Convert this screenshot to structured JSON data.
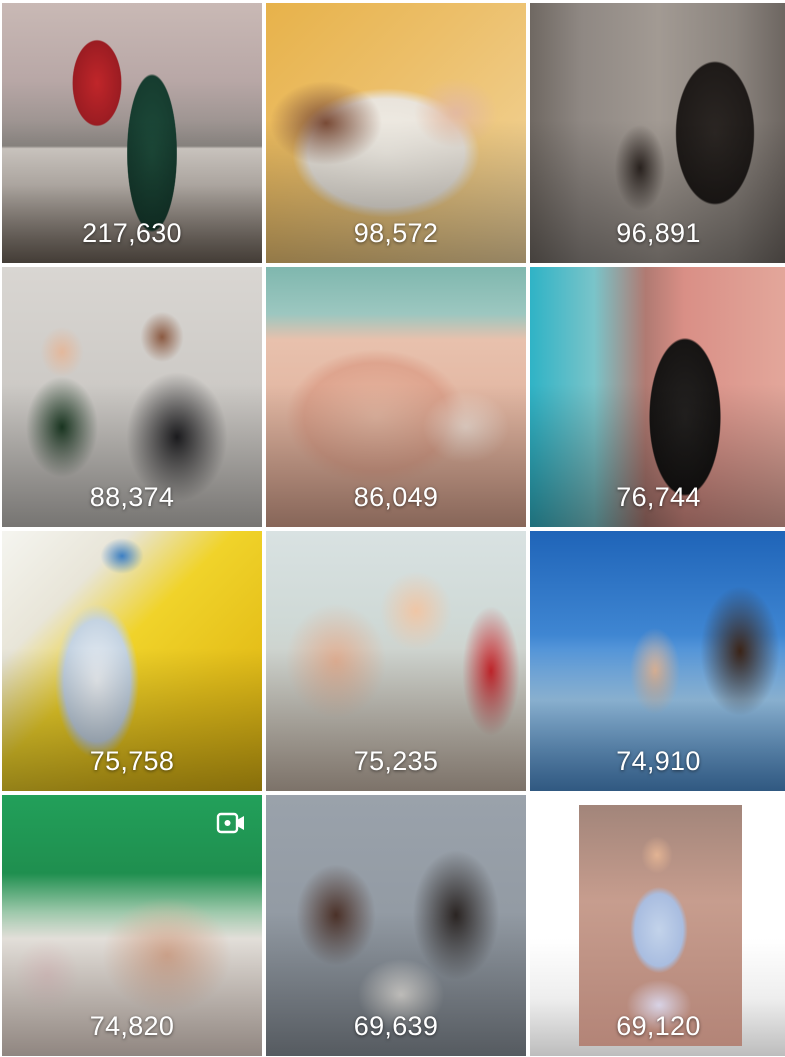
{
  "grid": {
    "tiles": [
      {
        "count": "217,630",
        "kind": "photo"
      },
      {
        "count": "98,572",
        "kind": "photo"
      },
      {
        "count": "96,891",
        "kind": "photo"
      },
      {
        "count": "88,374",
        "kind": "photo"
      },
      {
        "count": "86,049",
        "kind": "photo"
      },
      {
        "count": "76,744",
        "kind": "photo"
      },
      {
        "count": "75,758",
        "kind": "photo"
      },
      {
        "count": "75,235",
        "kind": "photo"
      },
      {
        "count": "74,910",
        "kind": "photo"
      },
      {
        "count": "74,820",
        "kind": "video",
        "icon": "video-icon"
      },
      {
        "count": "69,639",
        "kind": "photo"
      },
      {
        "count": "69,120",
        "kind": "photo"
      }
    ]
  },
  "colors": {
    "count_text": "#ffffff",
    "background": "#ffffff"
  }
}
